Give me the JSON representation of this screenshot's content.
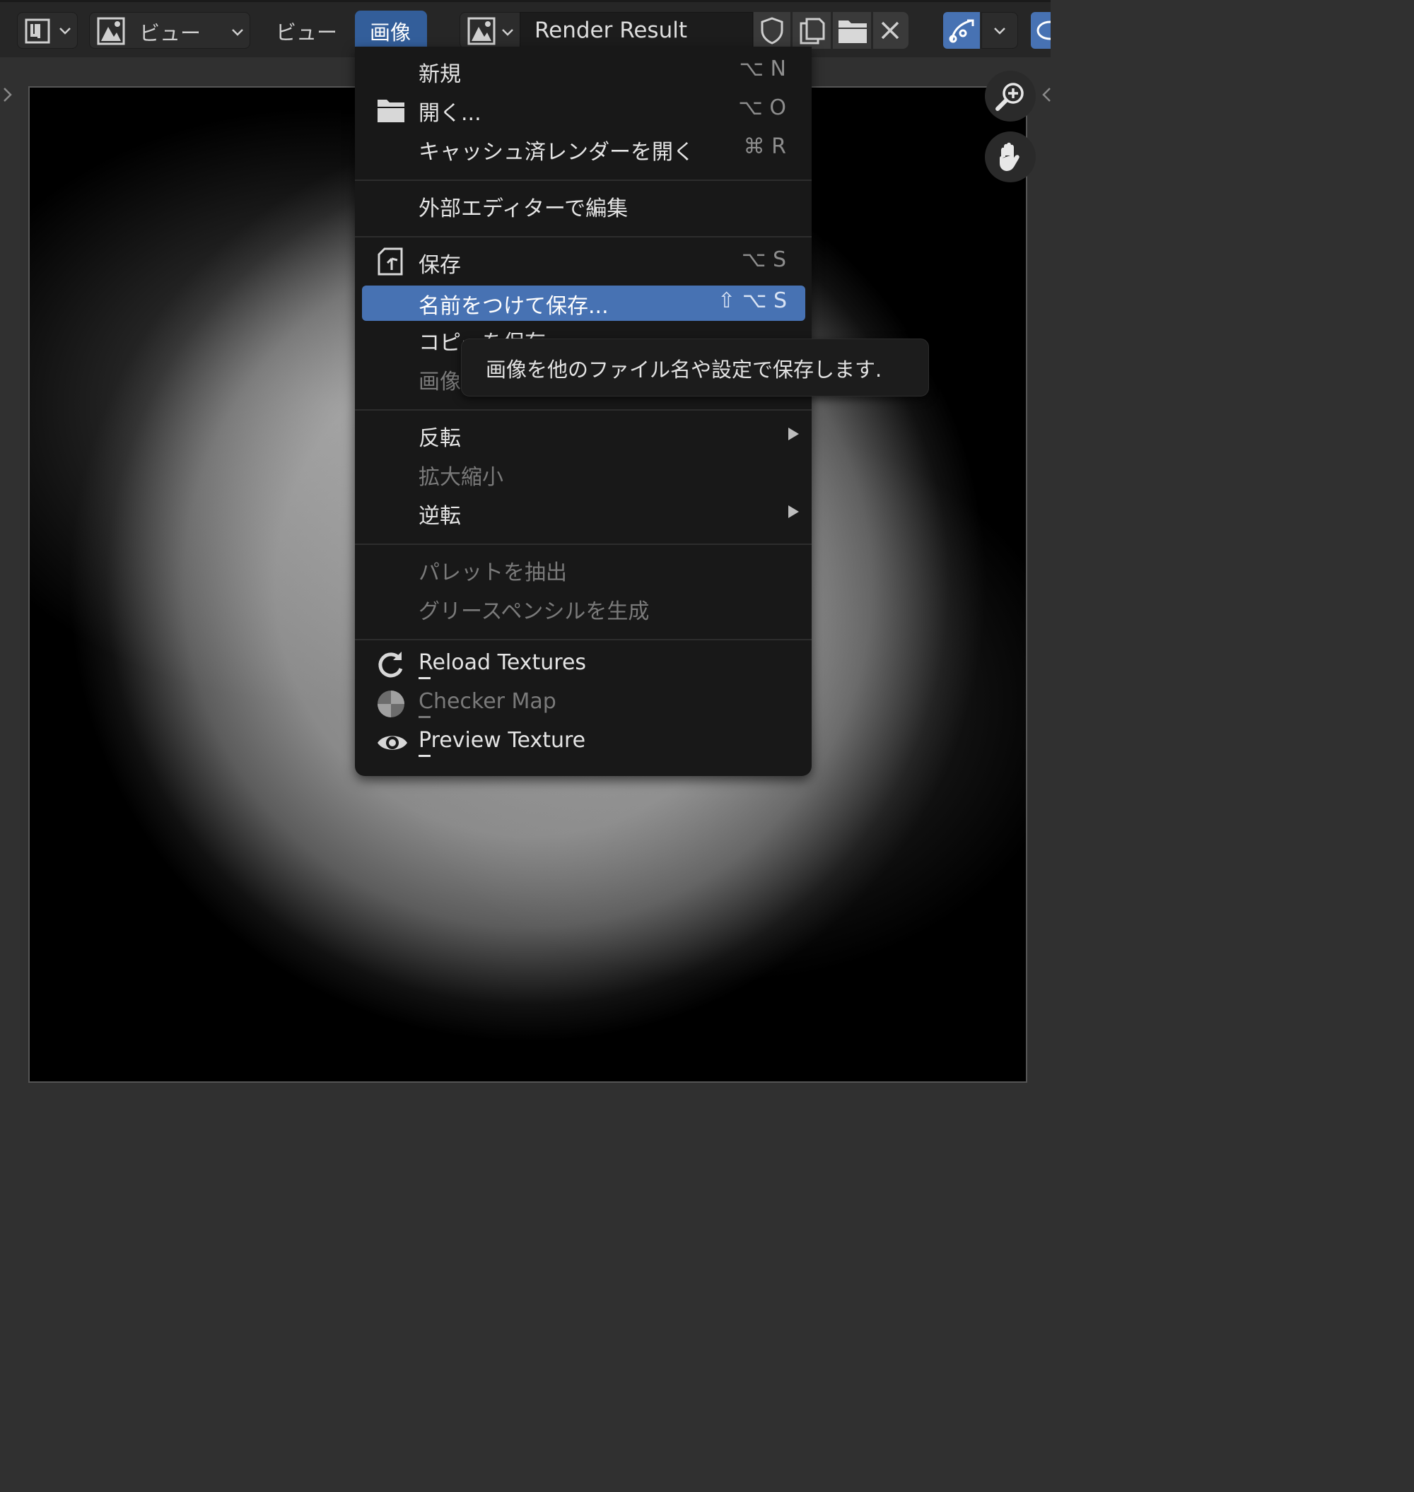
{
  "header": {
    "view_dropdown_label": "ビュー",
    "view_menu_label": "ビュー",
    "image_menu_label": "画像",
    "image_name": "Render Result"
  },
  "image_menu": {
    "items": [
      {
        "label": "新規",
        "shortcut": "⌥ N"
      },
      {
        "label": "開く...",
        "shortcut": "⌥ O"
      },
      {
        "label": "キャッシュ済レンダーを開く",
        "shortcut": "⌘ R"
      },
      {
        "label": "外部エディターで編集",
        "shortcut": ""
      },
      {
        "label": "保存",
        "shortcut": "⌥ S"
      },
      {
        "label": "名前をつけて保存...",
        "shortcut": "⇧ ⌥ S"
      },
      {
        "label": "コピーを保存",
        "shortcut": ""
      },
      {
        "label": "画像",
        "shortcut": ""
      },
      {
        "label": "反転",
        "shortcut": ""
      },
      {
        "label": "拡大縮小",
        "shortcut": ""
      },
      {
        "label": "逆転",
        "shortcut": ""
      },
      {
        "label": "パレットを抽出",
        "shortcut": ""
      },
      {
        "label": "グリースペンシルを生成",
        "shortcut": ""
      },
      {
        "label": "Reload Textures",
        "shortcut": ""
      },
      {
        "label": "Checker Map",
        "shortcut": ""
      },
      {
        "label": "Preview Texture",
        "shortcut": ""
      }
    ]
  },
  "tooltip": {
    "text": "画像を他のファイル名や設定で保存します."
  },
  "colors": {
    "highlight": "#4772b3",
    "menu_title_active": "#335e9a",
    "menu_bg": "#181818"
  }
}
